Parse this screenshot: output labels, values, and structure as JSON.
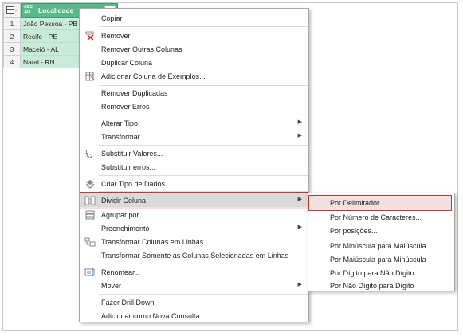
{
  "table": {
    "column_type": "ABC\n123",
    "column_name": "Localidade",
    "rows": [
      {
        "num": "1",
        "value": "João Pessoa - PB"
      },
      {
        "num": "2",
        "value": "Recife - PE"
      },
      {
        "num": "3",
        "value": "Maceió - AL"
      },
      {
        "num": "4",
        "value": "Natal - RN"
      }
    ]
  },
  "menu": {
    "items": [
      {
        "label": "Copiar"
      },
      {
        "label": "Remover"
      },
      {
        "label": "Remover Outras Colunas"
      },
      {
        "label": "Duplicar Coluna"
      },
      {
        "label": "Adicionar Coluna de Exemplos..."
      },
      {
        "label": "Remover Duplicadas"
      },
      {
        "label": "Remover Erros"
      },
      {
        "label": "Alterar Tipo"
      },
      {
        "label": "Transformar"
      },
      {
        "label": "Substituir Valores..."
      },
      {
        "label": "Substituir erros..."
      },
      {
        "label": "Criar Tipo de Dados"
      },
      {
        "label": "Dividir Coluna"
      },
      {
        "label": "Agrupar por..."
      },
      {
        "label": "Preenchimento"
      },
      {
        "label": "Transformar Colunas em Linhas"
      },
      {
        "label": "Transformar Somente as Colunas Selecionadas em Linhas"
      },
      {
        "label": "Renomear..."
      },
      {
        "label": "Mover"
      },
      {
        "label": "Fazer Drill Down"
      },
      {
        "label": "Adicionar como Nova Consulta"
      }
    ]
  },
  "submenu": {
    "items": [
      {
        "label": "Por Delimitador..."
      },
      {
        "label": "Por Número de Caracteres..."
      },
      {
        "label": "Por posições..."
      },
      {
        "label": "Por Minúscula para Maiúscula"
      },
      {
        "label": "Por Maiúscula para Minúscula"
      },
      {
        "label": "Por Dígito para Não Dígito"
      },
      {
        "label": "Por Não Dígito para Dígito"
      }
    ]
  },
  "colors": {
    "column_header": "#5ab88a",
    "cell_selected": "#c9ecd9",
    "highlight_border": "#c0392b"
  }
}
